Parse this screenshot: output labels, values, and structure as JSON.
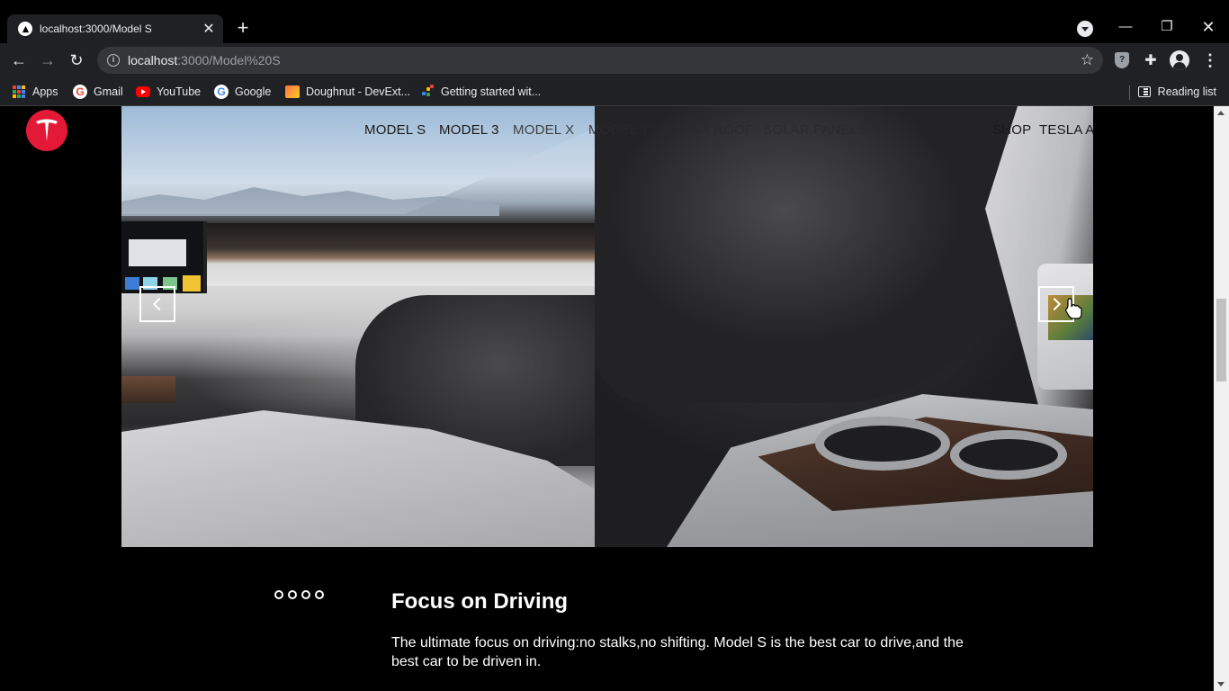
{
  "browser": {
    "tab_title": "localhost:3000/Model S",
    "url_host": "localhost",
    "url_rest": ":3000/Model%20S",
    "bookmarks": [
      "Apps",
      "Gmail",
      "YouTube",
      "Google",
      "Doughnut - DevExt...",
      "Getting started wit..."
    ],
    "reading_list": "Reading list"
  },
  "nav": {
    "items": [
      "MODEL S",
      "MODEL 3",
      "MODEL X",
      "MODEL Y",
      "SOLAR ROOF",
      "SOLAR PANELS",
      "SHOP",
      "TESLA A"
    ]
  },
  "hero": {
    "dots_count": 4
  },
  "feature": {
    "title": "Focus on Driving",
    "text": "The ultimate focus on driving:no stalks,no shifting. Model S is the best car to drive,and the best car to be driven in."
  },
  "colors": {
    "logo": "#e31937",
    "background": "#000000",
    "chrome": "#202124"
  }
}
